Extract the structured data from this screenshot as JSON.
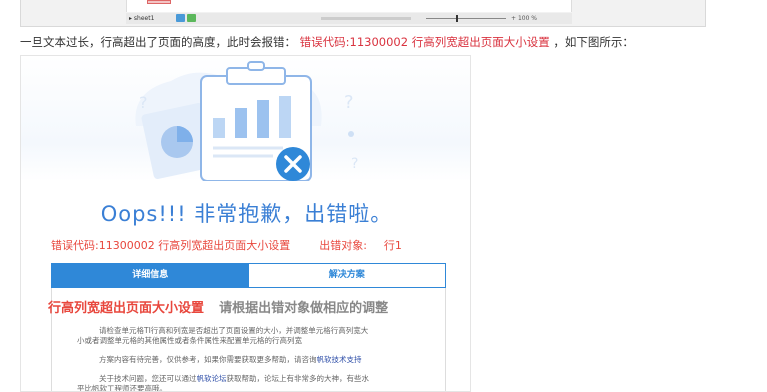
{
  "spreadsheet_preview": {
    "sheet_name": "sheet1",
    "zoom": "100"
  },
  "sentence": {
    "prefix": "一旦文本过长，行高超出了页面的高度，此时会报错：",
    "error_code": "错误代码:11300002 行高列宽超出页面大小设置",
    "suffix": "，如下图所示："
  },
  "error_page": {
    "headline": "Oops!!! 非常抱歉，出错啦。",
    "error_code_text": "错误代码:11300002 行高列宽超出页面大小设置",
    "error_object_label": "出错对象:",
    "error_object_value": "行1",
    "tabs": [
      "详细信息",
      "解决方案"
    ],
    "detail_title_red": "行高列宽超出页面大小设置",
    "detail_title_gray": "请根据出错对象做相应的调整",
    "para1_line1": "请检查单元格TI行高和列宽是否超出了页面设置的大小，并调整单元格行高列宽大",
    "para1_line2": "小或者调整单元格的其他属性或者条件属性来配置单元格的行高列宽",
    "para2_text": "方案内容有待完善，仅供参考，如果你需要获取更多帮助，请咨询",
    "para2_link": "帆软技术支持",
    "para3_prefix": "关于技术问题，您还可以通过",
    "para3_link": "帆软论坛",
    "para3_suffix": "获取帮助，论坛上有非常多的大神，有些水",
    "para3_line2": "平比帆软工程师还要高哦。"
  },
  "colors": {
    "accent_blue": "#2f88d8",
    "error_red": "#e8473d",
    "text_red": "#d9333f"
  }
}
